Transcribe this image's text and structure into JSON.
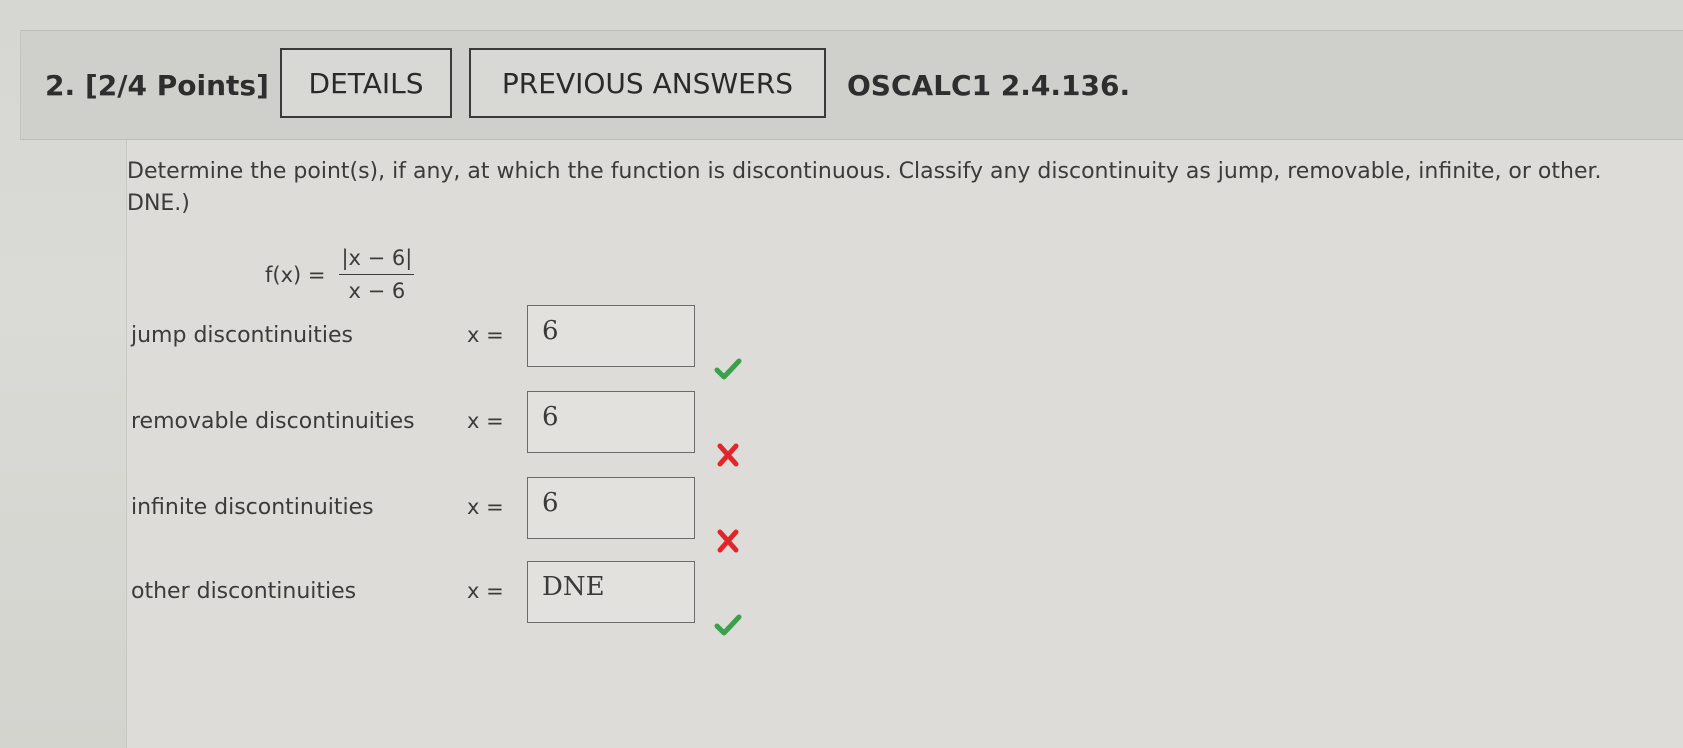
{
  "header": {
    "question_number": "2.",
    "points": "[2/4 Points]",
    "details_label": "DETAILS",
    "previous_answers_label": "PREVIOUS ANSWERS",
    "source": "OSCALC1 2.4.136."
  },
  "question": {
    "prompt_line1": "Determine the point(s), if any, at which the function is discontinuous. Classify any discontinuity as jump, removable, infinite, or other.",
    "prompt_line2": "DNE.)",
    "function_lhs": "f(x) =",
    "function_numerator": "|x − 6|",
    "function_denominator": "x − 6"
  },
  "rows": [
    {
      "label": "jump discontinuities",
      "var_label": "x =",
      "value": "6",
      "status": "correct",
      "status_icon": "check-icon"
    },
    {
      "label": "removable discontinuities",
      "var_label": "x =",
      "value": "6",
      "status": "incorrect",
      "status_icon": "cross-icon"
    },
    {
      "label": "infinite discontinuities",
      "var_label": "x =",
      "value": "6",
      "status": "incorrect",
      "status_icon": "cross-icon"
    },
    {
      "label": "other discontinuities",
      "var_label": "x =",
      "value": "DNE",
      "status": "correct",
      "status_icon": "check-icon"
    }
  ],
  "colors": {
    "correct": "#3aa14a",
    "incorrect": "#e0252b"
  }
}
